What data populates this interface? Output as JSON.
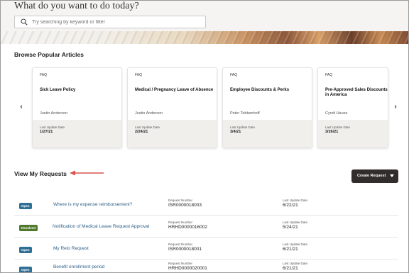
{
  "hero": {
    "title": "What do you want to do today?",
    "search_placeholder": "Try searching by keyword or filter"
  },
  "articles": {
    "title": "Browse Popular Articles",
    "prev_icon": "chevron-left-icon",
    "next_icon": "chevron-right-icon",
    "cards": [
      {
        "type": "FAQ",
        "title": "Sick Leave Policy",
        "author": "Justin Anderson",
        "date_label": "Last Update Date",
        "date": "1/27/21"
      },
      {
        "type": "FAQ",
        "title": "Medical / Pregnancy Leave of Absence",
        "author": "Justin Anderson",
        "date_label": "Last Update Date",
        "date": "2/24/21"
      },
      {
        "type": "FAQ",
        "title": "Employee Discounts & Perks",
        "author": "Peter Tebbenhoff",
        "date_label": "Last Update Date",
        "date": "3/4/21"
      },
      {
        "type": "FAQ",
        "title": "Pre-Approved Sales Discounts in America",
        "author": "Cyndi Hause",
        "date_label": "Last Update Date",
        "date": "3/26/21"
      }
    ]
  },
  "requests": {
    "title": "View My Requests",
    "create_label": "Create Request",
    "rows": [
      {
        "status": "Open",
        "status_color": "#2f6f95",
        "title": "Where is my expense reimbursement?",
        "number_label": "Request Number",
        "number": "ISR0000018003",
        "date_label": "Last Update Date",
        "date": "6/22/21"
      },
      {
        "status": "Resolved",
        "status_color": "#4f7a2c",
        "title": "Notification of Medical Leave Request Approval",
        "number_label": "Request Number",
        "number": "HRHD0000016002",
        "date_label": "Last Update Date",
        "date": "5/24/21"
      },
      {
        "status": "Open",
        "status_color": "#2f6f95",
        "title": "My Relo Request",
        "number_label": "Request Number",
        "number": "ISR0000018001",
        "date_label": "Last Update Date",
        "date": "6/21/21"
      },
      {
        "status": "Open",
        "status_color": "#2f6f95",
        "title": "Benefit enrollment period",
        "number_label": "Request Number",
        "number": "HRHD0000020001",
        "date_label": "Last Update Date",
        "date": "6/21/21"
      }
    ]
  },
  "colors": {
    "accent_arrow": "#d9534f",
    "button_dark": "#312d2a",
    "link": "#2c5f87"
  }
}
